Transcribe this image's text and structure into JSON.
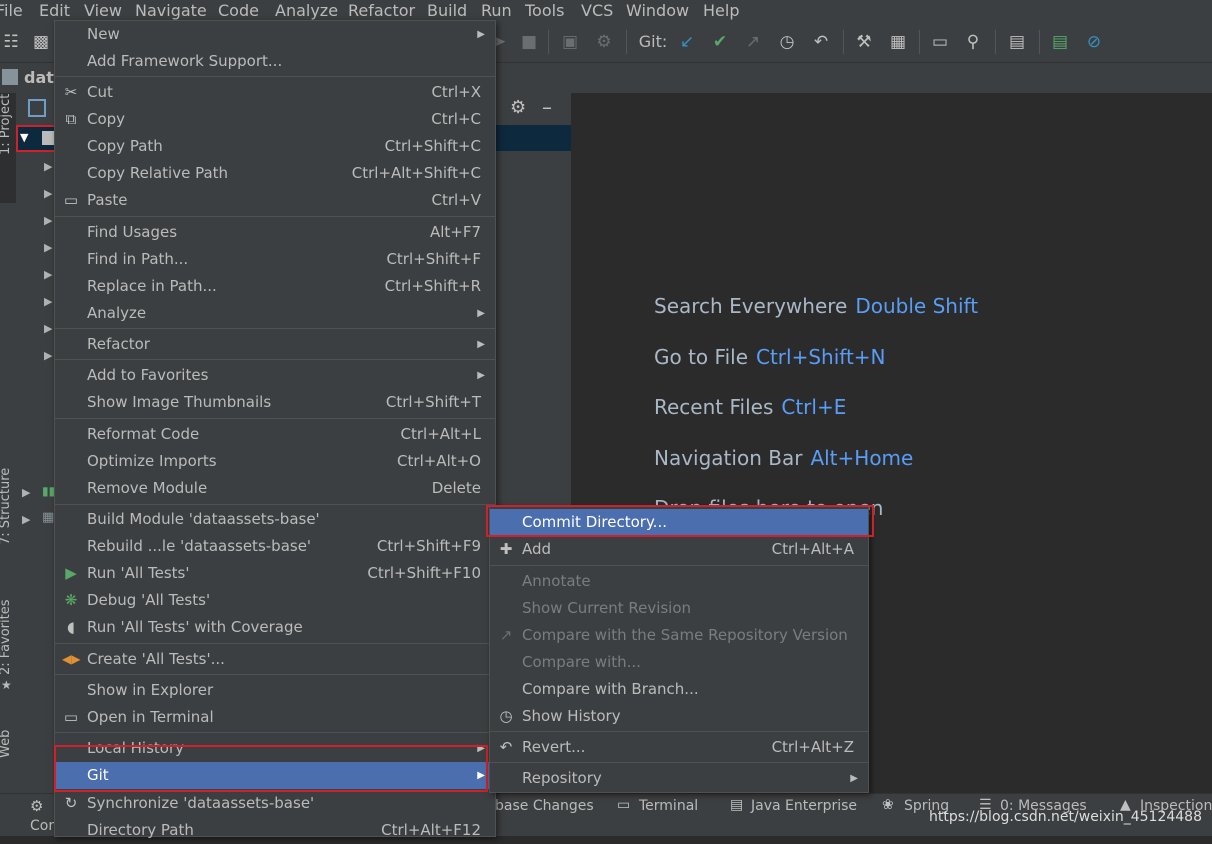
{
  "menubar": {
    "items": [
      "File",
      "Edit",
      "View",
      "Navigate",
      "Code",
      "Analyze",
      "Refactor",
      "Build",
      "Run",
      "Tools",
      "VCS",
      "Window",
      "Help"
    ]
  },
  "toolbar": {
    "git_label": "Git:"
  },
  "navbar": {
    "crumb": "data"
  },
  "sidestripe": {
    "project": "1: Project",
    "structure": "7: Structure",
    "favorites": "2: Favorites",
    "web": "Web"
  },
  "editor": {
    "hints": [
      {
        "text": "Search Everywhere",
        "key": "Double Shift"
      },
      {
        "text": "Go to File",
        "key": "Ctrl+Shift+N"
      },
      {
        "text": "Recent Files",
        "key": "Ctrl+E"
      },
      {
        "text": "Navigation Bar",
        "key": "Alt+Home"
      },
      {
        "text": "Drop files here to open",
        "key": ""
      }
    ]
  },
  "context_menu": {
    "items": [
      {
        "label": "New",
        "shortcut": "",
        "submenu": true
      },
      {
        "label": "Add Framework Support...",
        "shortcut": ""
      },
      {
        "label": "Cut",
        "shortcut": "Ctrl+X",
        "icon": "scissors-icon"
      },
      {
        "label": "Copy",
        "shortcut": "Ctrl+C",
        "icon": "copy-icon"
      },
      {
        "label": "Copy Path",
        "shortcut": "Ctrl+Shift+C"
      },
      {
        "label": "Copy Relative Path",
        "shortcut": "Ctrl+Alt+Shift+C"
      },
      {
        "label": "Paste",
        "shortcut": "Ctrl+V",
        "icon": "paste-icon"
      },
      {
        "label": "Find Usages",
        "shortcut": "Alt+F7"
      },
      {
        "label": "Find in Path...",
        "shortcut": "Ctrl+Shift+F"
      },
      {
        "label": "Replace in Path...",
        "shortcut": "Ctrl+Shift+R"
      },
      {
        "label": "Analyze",
        "shortcut": "",
        "submenu": true
      },
      {
        "label": "Refactor",
        "shortcut": "",
        "submenu": true
      },
      {
        "label": "Add to Favorites",
        "shortcut": "",
        "submenu": true
      },
      {
        "label": "Show Image Thumbnails",
        "shortcut": "Ctrl+Shift+T"
      },
      {
        "label": "Reformat Code",
        "shortcut": "Ctrl+Alt+L"
      },
      {
        "label": "Optimize Imports",
        "shortcut": "Ctrl+Alt+O"
      },
      {
        "label": "Remove Module",
        "shortcut": "Delete"
      },
      {
        "label": "Build Module 'dataassets-base'",
        "shortcut": ""
      },
      {
        "label": "Rebuild ...le 'dataassets-base'",
        "shortcut": "Ctrl+Shift+F9"
      },
      {
        "label": "Run 'All Tests'",
        "shortcut": "Ctrl+Shift+F10",
        "icon": "run-icon"
      },
      {
        "label": "Debug 'All Tests'",
        "shortcut": "",
        "icon": "debug-icon"
      },
      {
        "label": "Run 'All Tests' with Coverage",
        "shortcut": "",
        "icon": "coverage-icon"
      },
      {
        "label": "Create 'All Tests'...",
        "shortcut": "",
        "icon": "create-test-icon"
      },
      {
        "label": "Show in Explorer",
        "shortcut": ""
      },
      {
        "label": "Open in Terminal",
        "shortcut": "",
        "icon": "terminal-icon"
      },
      {
        "label": "Local History",
        "shortcut": "",
        "submenu": true
      },
      {
        "label": "Git",
        "shortcut": "",
        "submenu": true
      },
      {
        "label": "Synchronize 'dataassets-base'",
        "shortcut": "",
        "icon": "sync-icon"
      },
      {
        "label": "Directory Path",
        "shortcut": "Ctrl+Alt+F12"
      }
    ]
  },
  "git_submenu": {
    "items": [
      {
        "label": "Commit Directory...",
        "shortcut": ""
      },
      {
        "label": "Add",
        "shortcut": "Ctrl+Alt+A",
        "icon": "plus-icon"
      },
      {
        "label": "Annotate",
        "shortcut": "",
        "disabled": true
      },
      {
        "label": "Show Current Revision",
        "shortcut": "",
        "disabled": true
      },
      {
        "label": "Compare with the Same Repository Version",
        "shortcut": "",
        "disabled": true,
        "icon": "compare-icon"
      },
      {
        "label": "Compare with...",
        "shortcut": "",
        "disabled": true
      },
      {
        "label": "Compare with Branch...",
        "shortcut": ""
      },
      {
        "label": "Show History",
        "shortcut": "",
        "icon": "history-icon"
      },
      {
        "label": "Revert...",
        "shortcut": "Ctrl+Alt+Z",
        "icon": "revert-icon"
      },
      {
        "label": "Repository",
        "shortcut": "",
        "submenu": true
      }
    ]
  },
  "bottombar": {
    "tabs": [
      "base Changes",
      "Terminal",
      "Java Enterprise",
      "Spring",
      "0: Messages",
      "Inspection"
    ],
    "left_text": "Cor"
  },
  "watermark": "https://blog.csdn.net/weixin_45124488",
  "colors": {
    "accent": "#4b6eaf",
    "highlight_box": "#d0202a",
    "hint_key": "#589df6",
    "panel_bg": "#3c3f41",
    "editor_bg": "#2b2b2b"
  }
}
